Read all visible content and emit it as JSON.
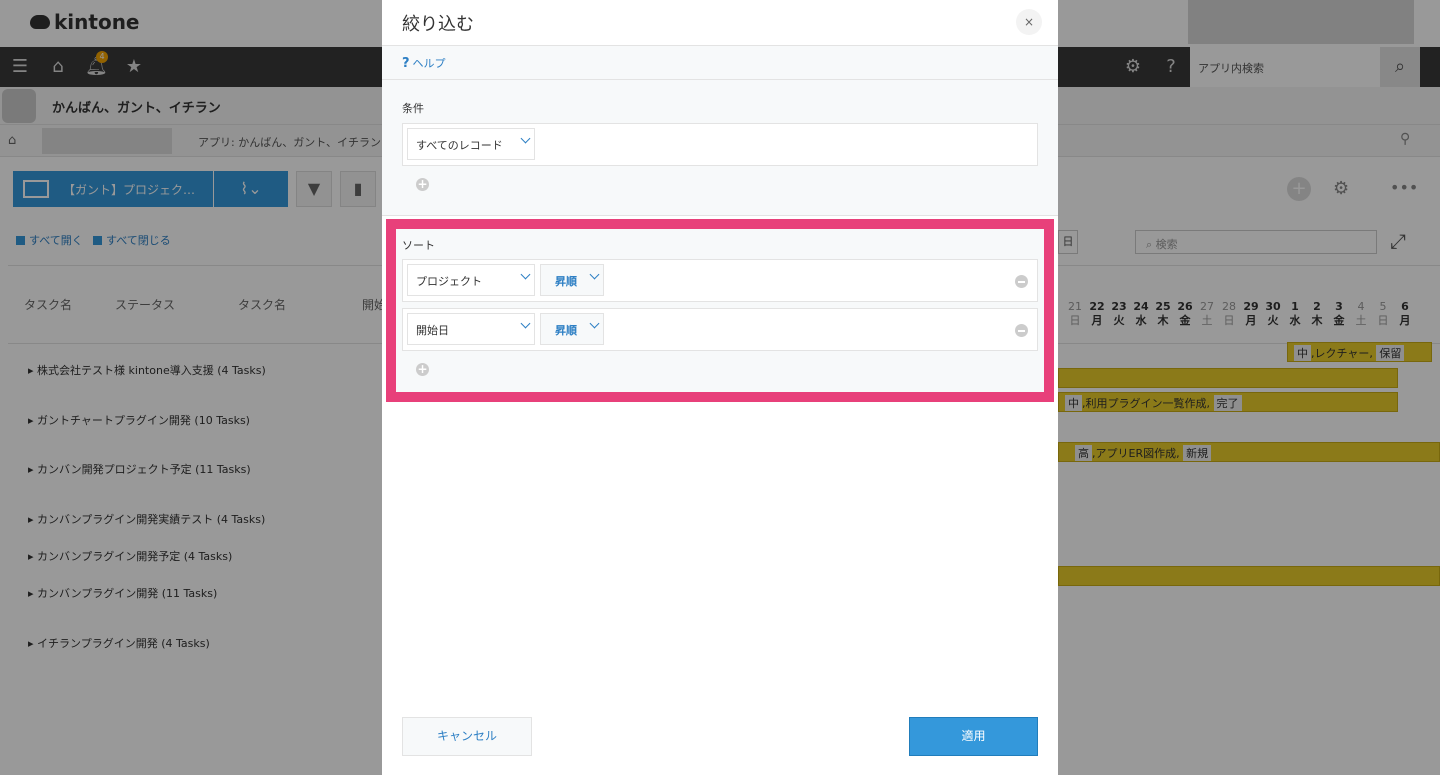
{
  "app": {
    "logo": "kintone",
    "notification_count": "4",
    "search_placeholder": "アプリ内検索",
    "title": "かんばん、ガント、イチラン",
    "breadcrumb_app": "アプリ: かんばん、ガント、イチラン"
  },
  "toolbar": {
    "view_name": "【ガント】プロジェク…",
    "expand_all": "すべて開く",
    "collapse_all": "すべて閉じる",
    "gantt_search_placeholder": "検索",
    "date_box": "日"
  },
  "grid": {
    "columns": [
      "タスク名",
      "ステータス",
      "タスク名",
      "開始"
    ],
    "projects": [
      "株式会社テスト様 kintone導入支援  (4 Tasks)",
      "ガントチャートプラグイン開発  (10 Tasks)",
      "カンバン開発プロジェクト予定  (11 Tasks)",
      "カンバンプラグイン開発実績テスト  (4 Tasks)",
      "カンバンプラグイン開発予定  (4 Tasks)",
      "カンバンプラグイン開発  (11 Tasks)",
      "イチランプラグイン開発  (4 Tasks)"
    ],
    "days": [
      {
        "n": "21",
        "w": "日"
      },
      {
        "n": "22",
        "w": "月"
      },
      {
        "n": "23",
        "w": "火"
      },
      {
        "n": "24",
        "w": "水"
      },
      {
        "n": "25",
        "w": "木"
      },
      {
        "n": "26",
        "w": "金"
      },
      {
        "n": "27",
        "w": "土"
      },
      {
        "n": "28",
        "w": "日"
      },
      {
        "n": "29",
        "w": "月"
      },
      {
        "n": "30",
        "w": "火"
      },
      {
        "n": "1",
        "w": "水"
      },
      {
        "n": "2",
        "w": "木"
      },
      {
        "n": "3",
        "w": "金"
      },
      {
        "n": "4",
        "w": "土"
      },
      {
        "n": "5",
        "w": "日"
      },
      {
        "n": "6",
        "w": "月"
      }
    ],
    "bars": {
      "bar1_priority": "中",
      "bar1_text": ",レクチャー,",
      "bar1_status": "保留",
      "bar2_priority": "中",
      "bar2_text": ",利用プラグイン一覧作成,",
      "bar2_status": "完了",
      "bar3_priority": "高",
      "bar3_text": ",アプリER図作成,",
      "bar3_status": "新規"
    }
  },
  "modal": {
    "title": "絞り込む",
    "close": "×",
    "help": "ヘルプ",
    "condition_label": "条件",
    "condition_select": "すべてのレコード",
    "sort_label": "ソート",
    "sort_rows": [
      {
        "field": "プロジェクト",
        "order": "昇順"
      },
      {
        "field": "開始日",
        "order": "昇順"
      }
    ],
    "cancel": "キャンセル",
    "apply": "適用"
  },
  "colors": {
    "accent": "#3498db",
    "highlight": "#e8407a",
    "gantt_bar": "#e8cc2a"
  }
}
